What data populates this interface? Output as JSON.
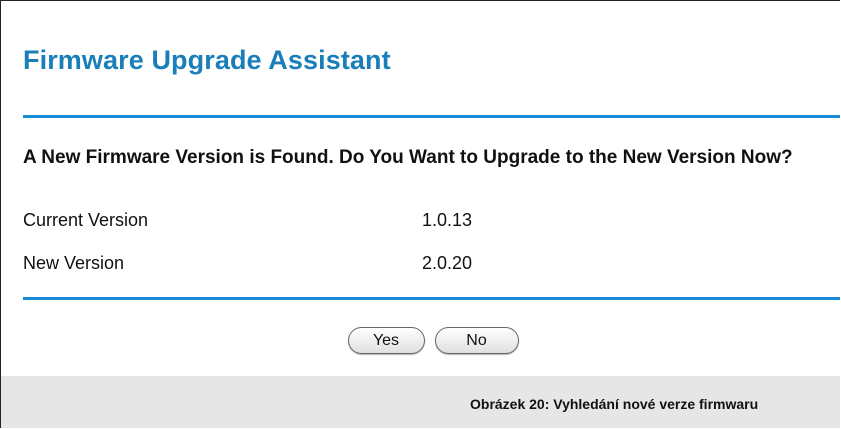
{
  "page": {
    "title": "Firmware Upgrade Assistant",
    "question": "A New Firmware Version is Found. Do You Want to Upgrade to the New Version Now?"
  },
  "versions": {
    "current_label": "Current Version",
    "current_value": "1.0.13",
    "new_label": "New Version",
    "new_value": "2.0.20"
  },
  "buttons": {
    "yes_label": "Yes",
    "no_label": "No"
  },
  "caption": {
    "text": "Obrázek 20: Vyhledání nové verze firmwaru"
  },
  "colors": {
    "accent": "#1a7fb8",
    "rule": "#1a8ad6",
    "caption_bg": "#e6e6e6"
  }
}
